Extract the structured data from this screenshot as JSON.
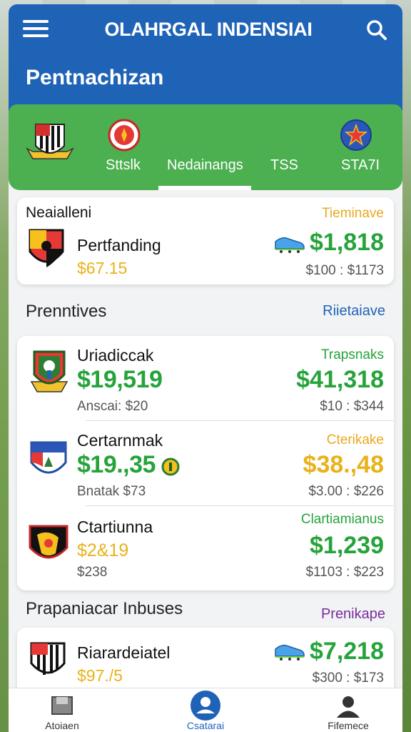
{
  "header": {
    "title": "OLAHRGAL INDENSIAI",
    "heading": "Pentnachizan"
  },
  "tabs": [
    {
      "label": ""
    },
    {
      "label": "Sttslk"
    },
    {
      "label": "Nedainangs"
    },
    {
      "label": "TSS"
    },
    {
      "label": "STA7I"
    }
  ],
  "featured": {
    "section_label": "Neaialleni",
    "status": "Tieminave",
    "name": "Pertfanding",
    "left_price": "$67.15",
    "price": "$1,818",
    "sub": "$100 : $1173"
  },
  "section1": {
    "title": "Prenntives",
    "link": "Riietaiave",
    "rows": [
      {
        "name": "Uriadiccak",
        "left_price": "$19,519",
        "left_sub": "Anscai: $20",
        "right_label": "Trapsnaks",
        "right_price": "$41,318",
        "right_sub": "$10 : $344"
      },
      {
        "name": "Certarnmak",
        "left_price": "$19.,35",
        "left_sub": "Bnatak $73",
        "right_label": "Cterikake",
        "right_price": "$38.,48",
        "right_sub": "$3.00 : $226"
      },
      {
        "name": "Ctartiunna",
        "left_price": "$2&19",
        "left_sub": "$238",
        "right_label": "Clartiamianus",
        "right_price": "$1,239",
        "right_sub": "$1103 : $223"
      }
    ]
  },
  "section2": {
    "title": "Prapaniacar Inbuses",
    "link": "Prenikape",
    "row": {
      "name": "Riarardeiatel",
      "left_price": "$97./5",
      "price": "$7,218",
      "sub": "$300 : $173"
    }
  },
  "bottom_nav": [
    {
      "label": "Atoiaen",
      "icon": "box-icon"
    },
    {
      "label": "Csatarai",
      "icon": "profile-icon"
    },
    {
      "label": "Fifemece",
      "icon": "person-icon"
    }
  ],
  "colors": {
    "header_blue": "#1f63b6",
    "tabs_green": "#4caf50",
    "price_green": "#26a33a",
    "price_gold": "#e9b21a",
    "link_blue": "#1f63b6",
    "link_purple": "#7b2d9a"
  }
}
